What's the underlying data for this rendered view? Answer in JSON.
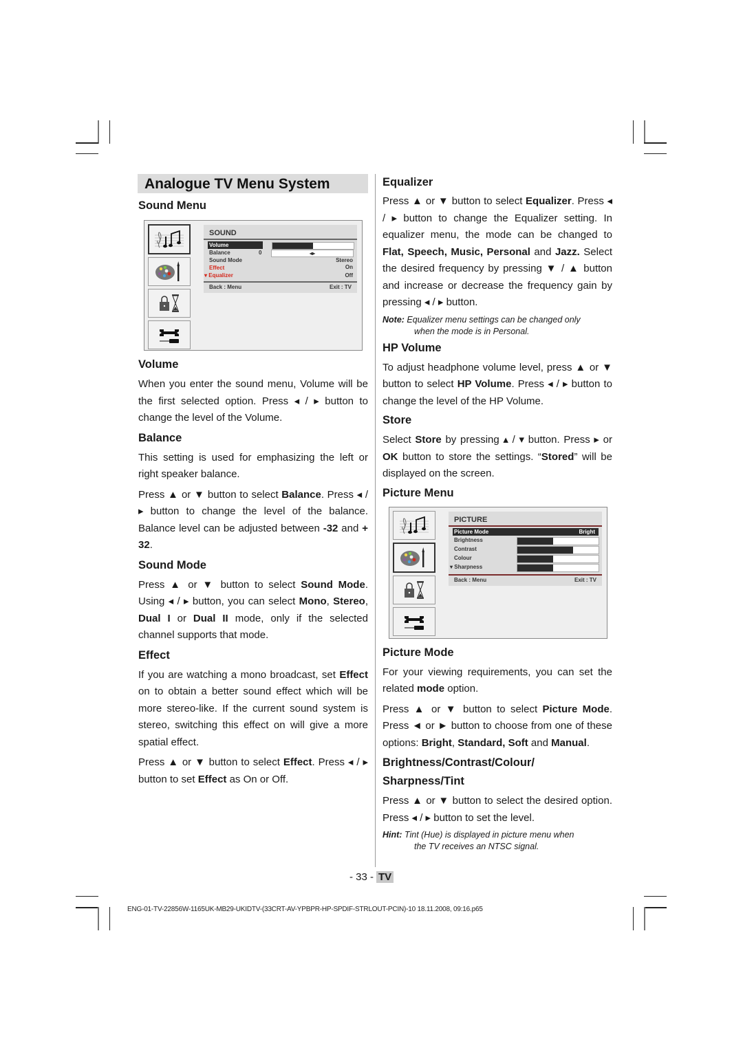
{
  "page_title": "Analogue TV Menu System",
  "left": {
    "sound_menu_heading": "Sound Menu",
    "volume": {
      "heading": "Volume",
      "p1": "When you enter the sound menu, Volume will be the first selected option. Press ◂ / ▸ button to change the level of the Volume."
    },
    "balance": {
      "heading": "Balance",
      "p1": "This setting is used for emphasizing the left or right speaker balance.",
      "p2_a": "Press ▲ or ▼ button to select ",
      "p2_b": "Balance",
      "p2_c": ". Press ◂ / ▸ button to change the level of the balance. Balance level can be adjusted between ",
      "p2_d": "-32",
      "p2_e": " and ",
      "p2_f": "+ 32",
      "p2_g": "."
    },
    "sound_mode": {
      "heading": "Sound Mode",
      "a": "Press ▲ or ▼ button to select ",
      "b": "Sound Mode",
      "c": ". Using ◂ / ▸ button, you can select ",
      "d": "Mono",
      "e": ", ",
      "f": "Stereo",
      "g": ", ",
      "h": "Dual I",
      "i": " or ",
      "j": "Dual II",
      "k": " mode, only if the selected channel supports that mode."
    },
    "effect": {
      "heading": "Effect",
      "p1_a": "If you are watching a mono broadcast, set ",
      "p1_b": "Effect",
      "p1_c": " on to obtain a better sound effect which will be more stereo-like. If the current sound system is stereo, switching this effect on will give a more spatial effect.",
      "p2_a": "Press ▲ or ▼ button to select ",
      "p2_b": "Effect",
      "p2_c": ". Press ◂ / ▸ button  to set ",
      "p2_d": "Effect",
      "p2_e": " as On or Off."
    }
  },
  "sound_osd": {
    "title": "SOUND",
    "rows": [
      {
        "label": "Volume",
        "fill": 0.5
      },
      {
        "label": "Balance",
        "value": "0",
        "slider": "◂▸"
      },
      {
        "label": "Sound Mode",
        "value": "Stereo"
      },
      {
        "label": "Effect",
        "value": "On"
      },
      {
        "label": "▾ Equalizer",
        "value": "Off"
      }
    ],
    "footer_left": "Back : Menu",
    "footer_right": "Exit : TV",
    "icons": [
      "music-notes-icon",
      "palette-icon",
      "lock-hourglass-icon",
      "wrench-screwdriver-icon"
    ]
  },
  "right": {
    "equalizer": {
      "heading": "Equalizer",
      "a": "Press ▲ or ▼ button to select ",
      "b": "Equalizer",
      "c": ". Press ◂ / ▸ button  to change the Equalizer setting. In equalizer menu, the mode can be changed to ",
      "d": "Flat, Speech, Music, Personal",
      "e": " and ",
      "f": "Jazz.",
      "g": " Select the desired frequency by pressing ▼ / ▲ button and increase or decrease the frequency gain by pressing ◂ / ▸ button.",
      "note_label": "Note:",
      "note_text": " Equalizer menu settings can be changed only",
      "note_text2": "when the mode is in Personal."
    },
    "hp_volume": {
      "heading": "HP Volume",
      "a": "To adjust headphone volume level, press ▲ or ▼ button to select ",
      "b": "HP Volume",
      "c": ". Press ◂ / ▸ button to change the level of the HP Volume."
    },
    "store": {
      "heading": "Store",
      "a": "Select ",
      "b": "Store",
      "c": " by pressing ▴ / ▾ button. Press ▸ or ",
      "d": "OK",
      "e": " button to store the settings. “",
      "f": "Stored",
      "g": "” will be displayed on the screen."
    },
    "picture_menu_heading": "Picture Menu",
    "picture_mode": {
      "heading": "Picture Mode",
      "p1_a": "For your viewing requirements, you can set the related ",
      "p1_b": "mode",
      "p1_c": " option.",
      "p2_a": "Press ▲ or ▼ button to select ",
      "p2_b": "Picture Mode",
      "p2_c": ". Press ◄ or ► button to choose from one of these options: ",
      "p2_d": "Bright",
      "p2_e": ", ",
      "p2_f": "Standard, Soft",
      "p2_g": " and ",
      "p2_h": "Manual",
      "p2_i": "."
    },
    "bcst": {
      "heading1": "Brightness/Contrast/Colour/",
      "heading2": "Sharpness/Tint",
      "p1": "Press ▲ or ▼ button to select the desired option. Press ◂ / ▸ button to set the level.",
      "hint_label": "Hint:",
      "hint_text": " Tint (Hue) is displayed in picture menu when",
      "hint_text2": "the TV receives an NTSC signal."
    }
  },
  "picture_osd": {
    "title": "PICTURE",
    "rows": [
      {
        "label": "Picture Mode",
        "value": "Bright"
      },
      {
        "label": "Brightness",
        "fill": 0.44
      },
      {
        "label": "Contrast",
        "fill": 0.69
      },
      {
        "label": "Colour",
        "fill": 0.44
      },
      {
        "label": "▾ Sharpness",
        "fill": 0.44
      }
    ],
    "footer_left": "Back : Menu",
    "footer_right": "Exit : TV"
  },
  "page_number": "- 33 -",
  "page_section": "TV",
  "footer_file": "ENG-01-TV-22856W-1165UK-MB29-UKIDTV-(33CRT-AV-YPBPR-HP-SPDIF-STRLOUT-PCIN)-10\t18.11.2008, 09:16.p65"
}
